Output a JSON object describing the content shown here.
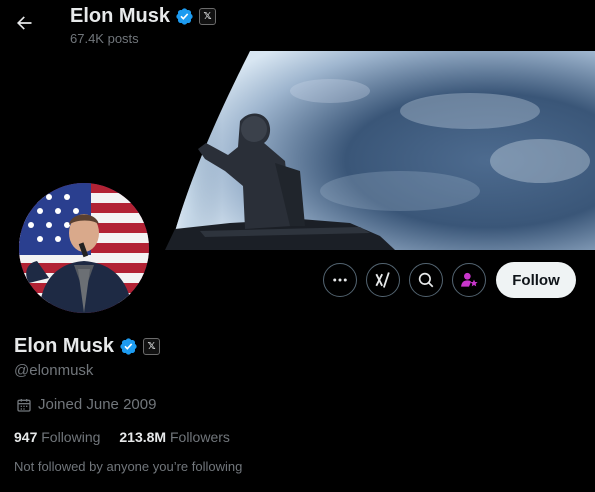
{
  "header": {
    "name": "Elon Musk",
    "posts": "67.4K posts",
    "x_badge": "𝕏"
  },
  "banner": {
    "description_icon": "space-banner"
  },
  "actions": {
    "more_icon": "more-icon",
    "grok_icon": "grok-icon",
    "search_icon": "search-icon",
    "subscribe_icon": "subscribe-icon",
    "follow_label": "Follow"
  },
  "profile": {
    "name": "Elon Musk",
    "handle": "@elonmusk",
    "joined": "Joined June 2009",
    "following_count": "947",
    "following_label": "Following",
    "followers_count": "213.8M",
    "followers_label": "Followers",
    "not_followed": "Not followed by anyone you’re following"
  },
  "colors": {
    "verified": "#1d9bf0",
    "subscribe": "#c936cc",
    "muted": "#71767b"
  }
}
